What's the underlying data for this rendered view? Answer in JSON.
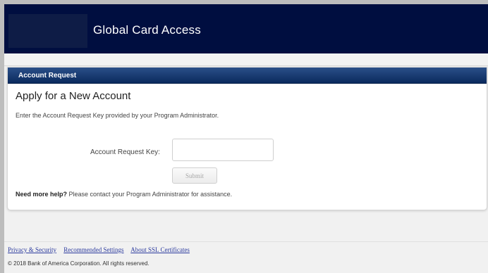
{
  "header": {
    "app_title": "Global Card Access"
  },
  "panel": {
    "header_label": "Account Request",
    "title": "Apply for a New Account",
    "instructions": "Enter the Account Request Key provided by your Program Administrator.",
    "key_field": {
      "label": "Account Request Key:",
      "value": "",
      "placeholder": ""
    },
    "submit_label": "Submit",
    "help_bold": "Need more help?",
    "help_text": " Please contact your Program Administrator for assistance."
  },
  "footer": {
    "links": [
      "Privacy & Security",
      "Recommended Settings",
      "About SSL Certificates"
    ],
    "copyright": "© 2018 Bank of America Corporation. All rights reserved."
  },
  "colors": {
    "header_bg": "#000e40",
    "panel_header_bg": "#0b2a5e",
    "link": "#2b3a9e"
  }
}
